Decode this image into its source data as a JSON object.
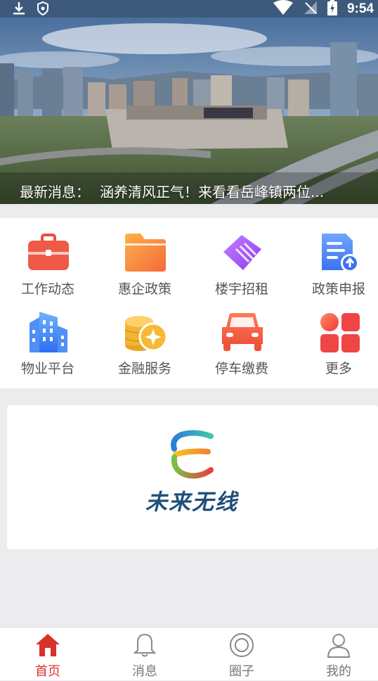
{
  "status_bar": {
    "time": "9:54"
  },
  "banner": {
    "news_label": "最新消息：",
    "news_text": "涵养清风正气！来看看岳峰镇两位..."
  },
  "services": [
    {
      "label": "工作动态",
      "icon": "briefcase-icon"
    },
    {
      "label": "惠企政策",
      "icon": "folder-icon"
    },
    {
      "label": "楼宇招租",
      "icon": "handshake-icon"
    },
    {
      "label": "政策申报",
      "icon": "document-upload-icon"
    },
    {
      "label": "物业平台",
      "icon": "building-icon"
    },
    {
      "label": "金融服务",
      "icon": "coins-icon"
    },
    {
      "label": "停车缴费",
      "icon": "car-icon"
    },
    {
      "label": "更多",
      "icon": "grid-icon"
    }
  ],
  "ad": {
    "brand_text": "未来无线"
  },
  "tabbar": [
    {
      "label": "首页",
      "icon": "home-icon",
      "active": true
    },
    {
      "label": "消息",
      "icon": "bell-icon",
      "active": false
    },
    {
      "label": "圈子",
      "icon": "circle-icon",
      "active": false
    },
    {
      "label": "我的",
      "icon": "user-icon",
      "active": false
    }
  ],
  "colors": {
    "accent": "#d8322a",
    "status_bar": "#3d5a7c",
    "brand_blue": "#1f4e79"
  }
}
